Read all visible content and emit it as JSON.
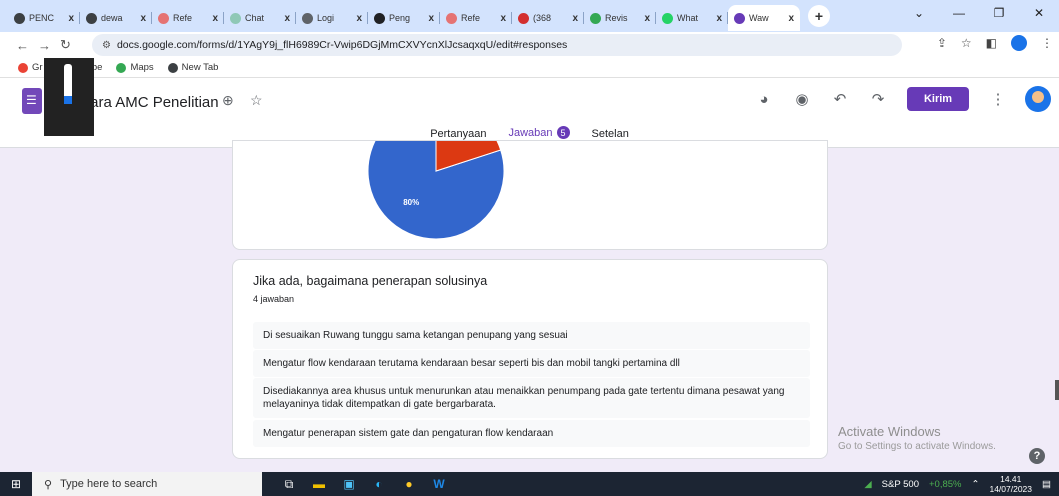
{
  "browser": {
    "tabs": [
      {
        "label": "PENC",
        "color": "#3c4043"
      },
      {
        "label": "dewa",
        "color": "#3c4043"
      },
      {
        "label": "Refe",
        "color": "#e57373"
      },
      {
        "label": "Chat",
        "color": "#8fc8b6"
      },
      {
        "label": "Logi",
        "color": "#5f6368"
      },
      {
        "label": "Peng",
        "color": "#202124"
      },
      {
        "label": "Refe",
        "color": "#e57373"
      },
      {
        "label": "(368",
        "color": "#d32f2f"
      },
      {
        "label": "Revis",
        "color": "#34a853"
      },
      {
        "label": "What",
        "color": "#25d366"
      },
      {
        "label": "Waw",
        "color": "#673ab7"
      }
    ],
    "tab_close": "x",
    "new_tab": "+",
    "window_controls": [
      "⌄",
      "—",
      "❐",
      "✕"
    ],
    "url": "docs.google.com/forms/d/1YAgY9j_flH6989Cr-Vwip6DGjMmCXVYcnXlJcsaqxqU/edit#responses",
    "bookmarks": [
      {
        "label": "Gr",
        "icon": "gmail-icon"
      },
      {
        "label": "ouTube",
        "icon": "youtube-icon"
      },
      {
        "label": "Maps",
        "icon": "maps-icon"
      },
      {
        "label": "New Tab",
        "icon": "globe-icon"
      }
    ]
  },
  "form": {
    "title": "ancara AMC Penelitian",
    "send_label": "Kirim",
    "tabs": [
      {
        "label": "Pertanyaan"
      },
      {
        "label": "Jawaban",
        "badge": "5"
      },
      {
        "label": "Setelan"
      }
    ]
  },
  "pie": {
    "type": "pie",
    "slices": [
      {
        "label": "80%",
        "value": 80,
        "color": "#3366cc"
      },
      {
        "label": "20%",
        "value": 20,
        "color": "#dc3912"
      }
    ]
  },
  "question": {
    "title": "Jika ada, bagaimana penerapan solusinya",
    "count": "4 jawaban",
    "answers": [
      "Di sesuaikan Ruwang tunggu sama ketangan penupang yang sesuai",
      "Mengatur flow kendaraan terutama kendaraan besar seperti bis dan mobil tangki pertamina dll",
      "Disediakannya area khusus untuk menurunkan atau menaikkan penumpang pada gate tertentu dimana pesawat yang melayaninya tidak ditempatkan di gate bergarbarata.",
      "Mengatur penerapan sistem gate dan pengaturan flow kendaraan"
    ]
  },
  "watermark": {
    "line1": "Activate Windows",
    "line2": "Go to Settings to activate Windows."
  },
  "taskbar": {
    "search_placeholder": "Type here to search",
    "stock_name": "S&P 500",
    "stock_change": "+0,85%",
    "time": "14.41",
    "date": "14/07/2023"
  }
}
